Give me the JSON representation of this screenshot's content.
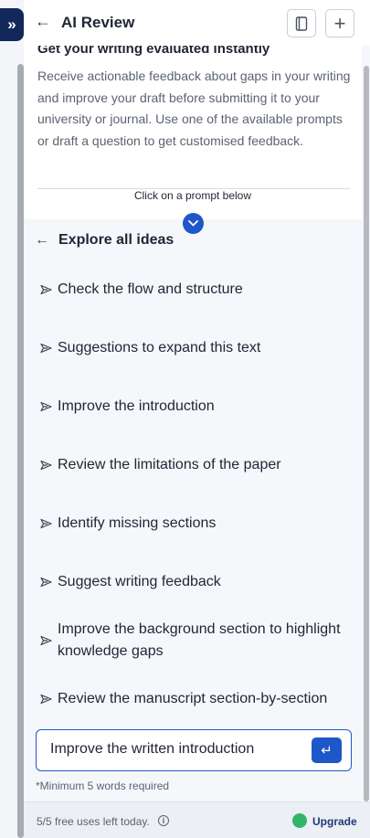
{
  "header": {
    "title": "AI Review",
    "back_icon": "arrow-left-icon",
    "notes_icon": "notebook-icon",
    "new_icon": "plus-icon",
    "expand_icon": "double-chevron-right-icon",
    "expand_glyph": "»",
    "back_glyph": "←",
    "new_glyph": "+"
  },
  "intro": {
    "heading": "Get your writing evaluated instantly",
    "description": "Receive actionable feedback about gaps in your writing and improve your draft before submitting it to your university or journal. Use one of the available prompts or draft a question to get customised feedback.",
    "hint": "Click on a prompt below"
  },
  "explore": {
    "label": "Explore all ideas",
    "glyph": "←"
  },
  "ideas": [
    "Check the flow and structure",
    "Suggestions to expand this text",
    "Improve the introduction",
    "Review the limitations of the paper",
    "Identify missing sections",
    "Suggest writing feedback",
    "Improve the background section to highlight knowledge gaps",
    "Review the manuscript section-by-section"
  ],
  "input": {
    "value": "Improve the written introduction",
    "send_glyph": "↵",
    "min_words_note": "*Minimum 5 words required"
  },
  "footer": {
    "uses_left": "5/5 free uses left today.",
    "info_glyph": "i",
    "upgrade_label": "Upgrade"
  },
  "colors": {
    "accent": "#1e57c7",
    "navy": "#12275a",
    "upgrade_green": "#34b46a"
  }
}
